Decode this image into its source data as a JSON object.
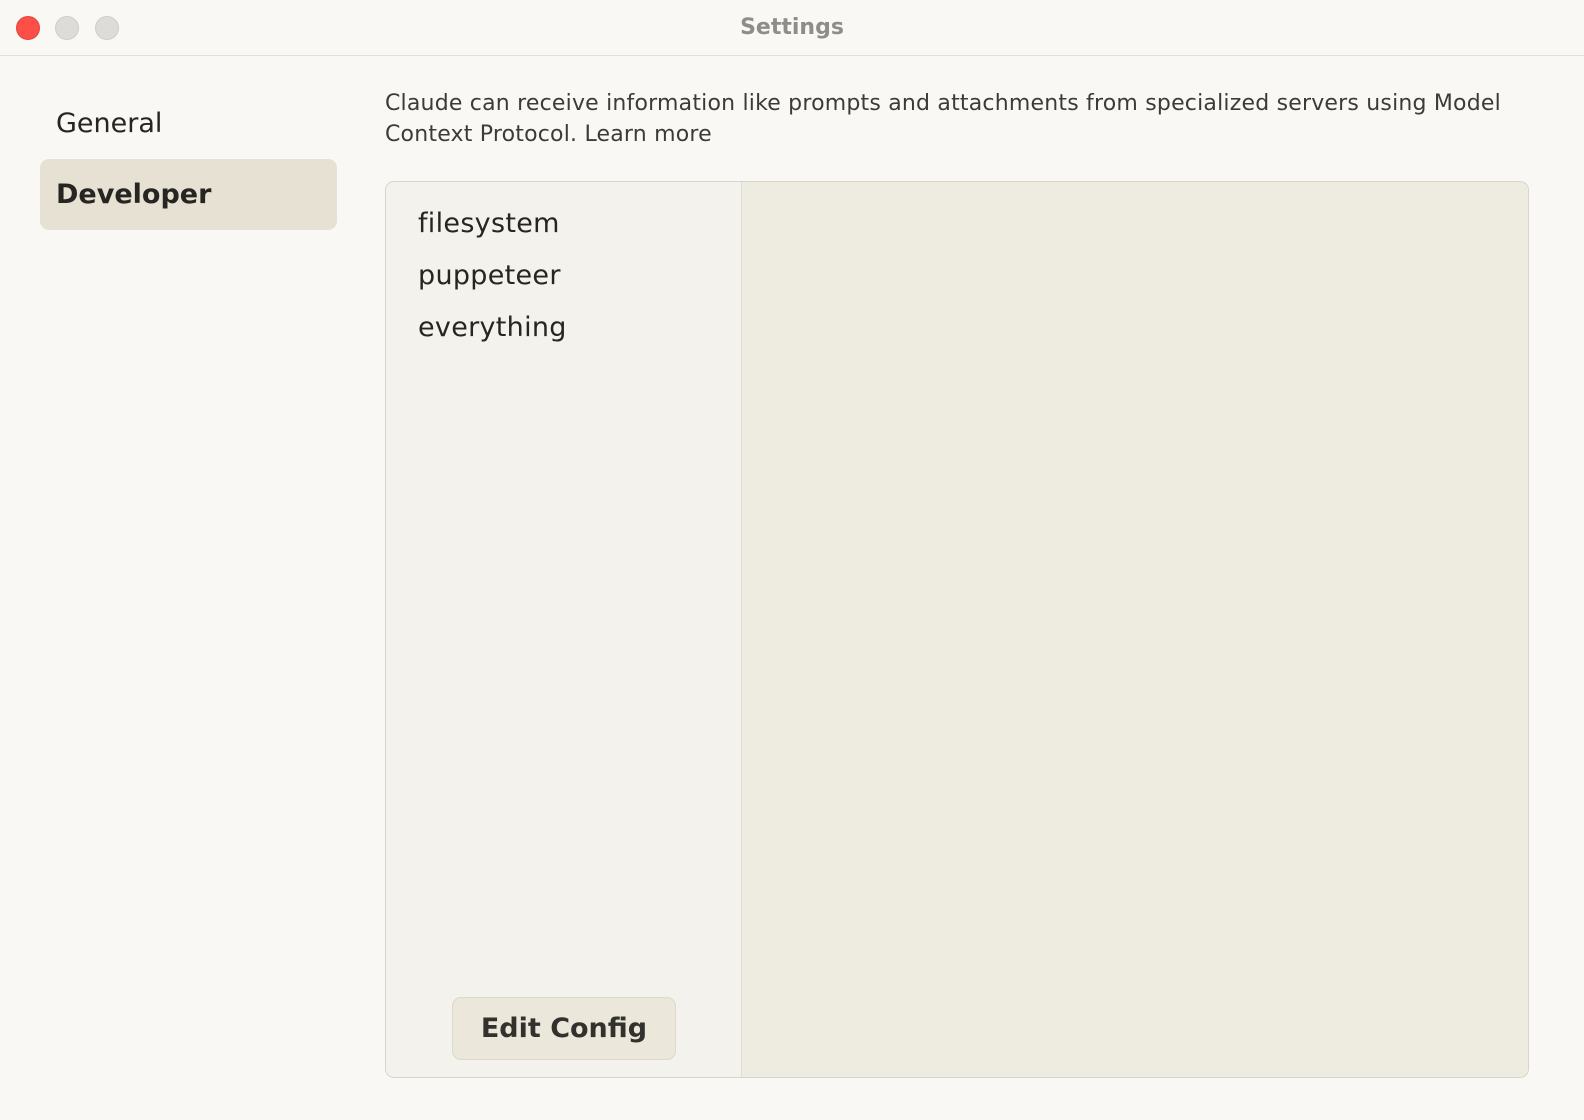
{
  "window": {
    "title": "Settings"
  },
  "nav": {
    "items": [
      {
        "label": "General",
        "active": false
      },
      {
        "label": "Developer",
        "active": true
      }
    ]
  },
  "developer": {
    "description": "Claude can receive information like prompts and attachments from specialized servers using Model Context Protocol.",
    "learn_more": "Learn more",
    "servers": [
      "filesystem",
      "puppeteer",
      "everything"
    ],
    "edit_config_label": "Edit Config"
  },
  "colors": {
    "close": "#fb4f47",
    "window_bg": "#f9f8f4",
    "active_nav_bg": "#e6e1d3",
    "detail_bg": "#eeebe0"
  }
}
